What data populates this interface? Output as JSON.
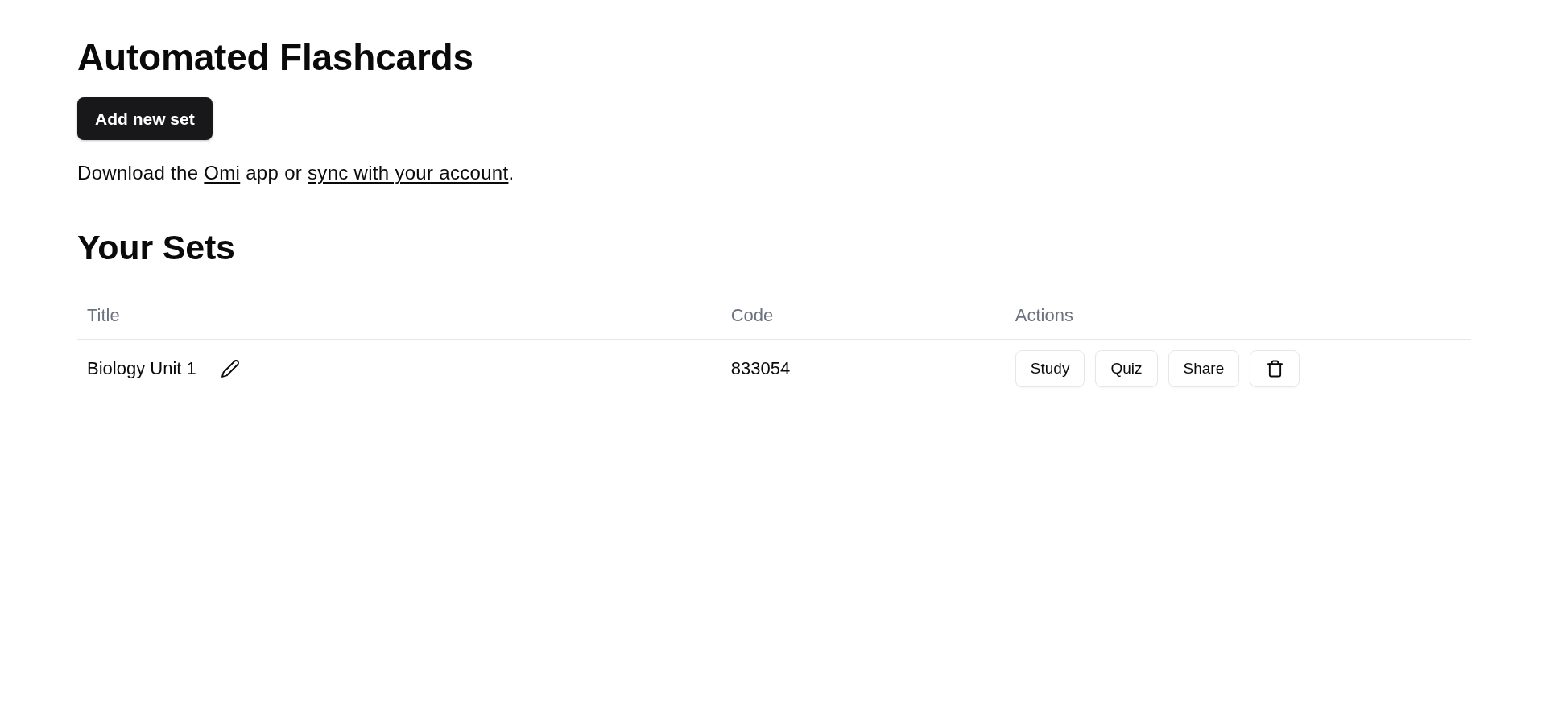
{
  "title": "Automated Flashcards",
  "add_button": {
    "label": "Add new set"
  },
  "intro": [
    {
      "kind": "text",
      "text": "Download the "
    },
    {
      "kind": "link",
      "text": "Omi"
    },
    {
      "kind": "text",
      "text": " app or "
    },
    {
      "kind": "link",
      "text": "sync with your account"
    },
    {
      "kind": "text",
      "text": "."
    }
  ],
  "sets_section": {
    "title": "Your Sets",
    "table": {
      "columns": [
        "Title",
        "Code",
        "Actions"
      ],
      "rows": [
        {
          "title": "Biology Unit 1",
          "code": "833054",
          "actions": [
            {
              "kind": "text",
              "label": "Study"
            },
            {
              "kind": "text",
              "label": "Quiz"
            },
            {
              "kind": "text",
              "label": "Share"
            },
            {
              "kind": "delete"
            }
          ]
        }
      ]
    }
  }
}
